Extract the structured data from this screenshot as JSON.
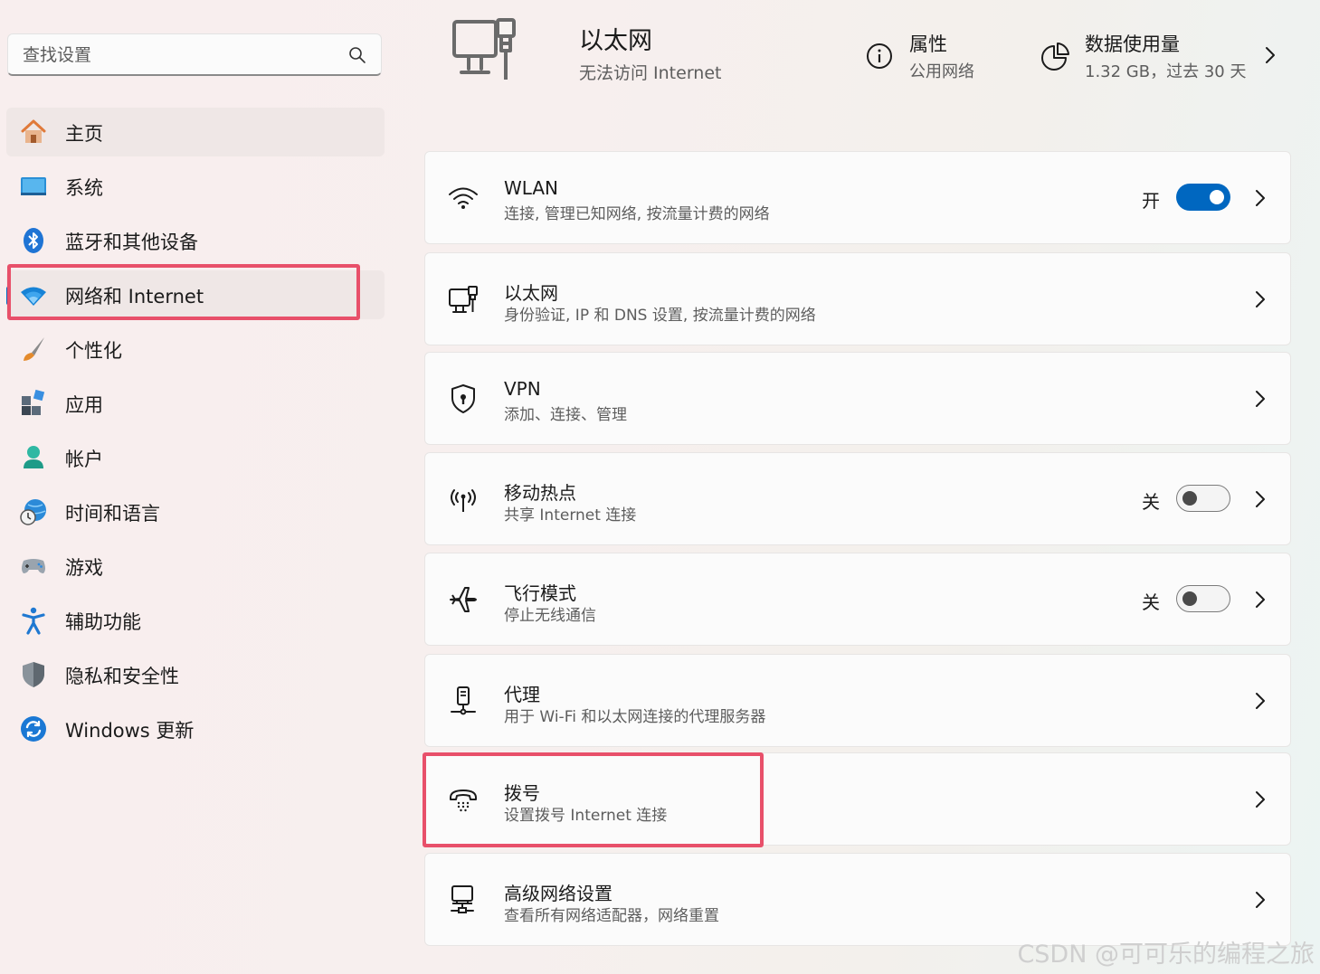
{
  "search": {
    "placeholder": "查找设置"
  },
  "sidebar": {
    "items": [
      {
        "label": "主页"
      },
      {
        "label": "系统"
      },
      {
        "label": "蓝牙和其他设备"
      },
      {
        "label": "网络和 Internet"
      },
      {
        "label": "个性化"
      },
      {
        "label": "应用"
      },
      {
        "label": "帐户"
      },
      {
        "label": "时间和语言"
      },
      {
        "label": "游戏"
      },
      {
        "label": "辅助功能"
      },
      {
        "label": "隐私和安全性"
      },
      {
        "label": "Windows 更新"
      }
    ]
  },
  "header": {
    "title": "以太网",
    "status": "无法访问 Internet",
    "properties_label": "属性",
    "properties_value": "公用网络",
    "usage_label": "数据使用量",
    "usage_value": "1.32 GB，过去 30 天"
  },
  "cards": [
    {
      "title": "WLAN",
      "subtitle": "连接, 管理已知网络, 按流量计费的网络",
      "toggle_state": "开",
      "icon": "wifi-icon"
    },
    {
      "title": "以太网",
      "subtitle": "身份验证, IP 和 DNS 设置, 按流量计费的网络",
      "icon": "ethernet-icon"
    },
    {
      "title": "VPN",
      "subtitle": "添加、连接、管理",
      "icon": "vpn-shield-icon"
    },
    {
      "title": "移动热点",
      "subtitle": "共享 Internet 连接",
      "toggle_state": "关",
      "icon": "hotspot-icon"
    },
    {
      "title": "飞行模式",
      "subtitle": "停止无线通信",
      "toggle_state": "关",
      "icon": "airplane-icon"
    },
    {
      "title": "代理",
      "subtitle": "用于 Wi-Fi 和以太网连接的代理服务器",
      "icon": "proxy-icon"
    },
    {
      "title": "拨号",
      "subtitle": "设置拨号 Internet 连接",
      "icon": "dialup-phone-icon"
    },
    {
      "title": "高级网络设置",
      "subtitle": "查看所有网络适配器，网络重置",
      "icon": "network-adapter-icon"
    }
  ],
  "watermark": "CSDN @可可乐的编程之旅",
  "colors": {
    "accent": "#0067c0",
    "highlight": "#e8506a"
  }
}
